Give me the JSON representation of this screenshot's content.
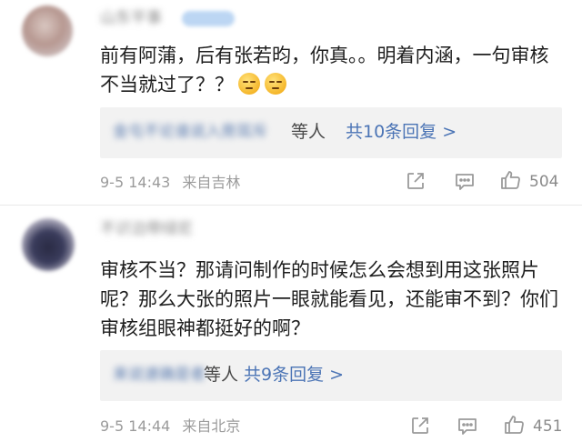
{
  "comments": [
    {
      "username": "山东平事",
      "text": "前有阿蒲，后有张若昀，你真。。明着内涵，一句审核不当就过了？？",
      "emoji_count": 2,
      "emoji_icon": "face-with-tears-emoji",
      "reply_users": "金屯不论谁说入旁耳斥",
      "reply_suffix": "等人",
      "reply_count": "共10条回复 >",
      "time": "9-5 14:43",
      "location": "来自吉林",
      "likes": "504"
    },
    {
      "username": "不识泊带绿尼",
      "text": "审核不当？那请问制作的时候怎么会想到用这张照片呢？那么大张的照片一眼就能看见，还能审不到？你们审核组眼神都挺好的啊？",
      "reply_users": "来说速确是者",
      "reply_suffix": "等人",
      "reply_count": "共9条回复 >",
      "time": "9-5 14:44",
      "location": "来自北京",
      "likes": "451"
    }
  ],
  "colors": {
    "link": "#4b74b5",
    "meta": "#9b9b9b",
    "reply_bg": "#f2f2f2"
  }
}
